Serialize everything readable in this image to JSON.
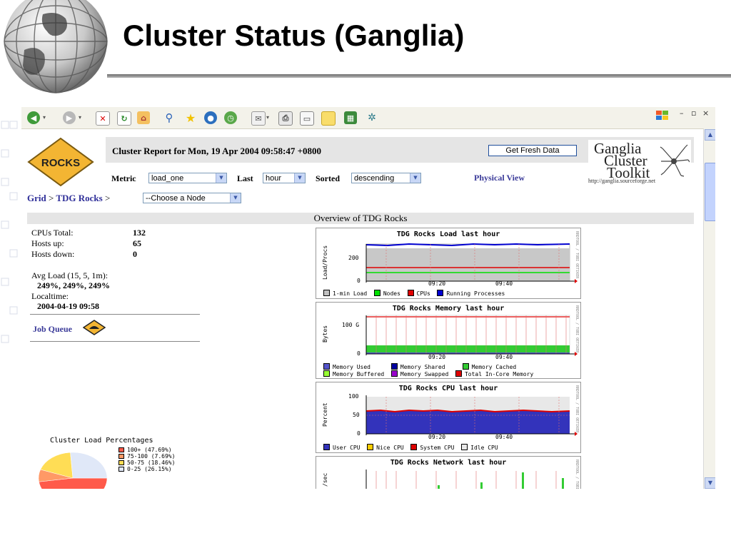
{
  "slide": {
    "title": "Cluster Status (Ganglia)"
  },
  "browser": {
    "toolbar_icons": [
      "back-icon",
      "forward-icon",
      "stop-icon",
      "refresh-icon",
      "home-icon",
      "search-icon",
      "favorites-star-icon",
      "media-icon",
      "history-icon",
      "mail-icon",
      "print-icon",
      "edit-icon",
      "folder-icon",
      "messenger-icon",
      "bluetooth-icon"
    ],
    "window_controls": {
      "minimize": "–",
      "restore": "▫",
      "close": "×"
    }
  },
  "header": {
    "logo_text": "ROCKS",
    "report_title": "Cluster Report for Mon, 19 Apr 2004 09:58:47 +0800",
    "fresh_button": "Get Fresh Data",
    "metric_label": "Metric",
    "metric_value": "load_one",
    "last_label": "Last",
    "last_value": "hour",
    "sorted_label": "Sorted",
    "sorted_value": "descending",
    "physical_view": "Physical View",
    "ganglia_logo": {
      "line1": "Ganglia",
      "line2": "Cluster",
      "line3": "Toolkit",
      "url": "http://ganglia.sourceforge.net"
    }
  },
  "breadcrumb": {
    "grid": "Grid",
    "sep1": ">",
    "cluster": "TDG Rocks",
    "sep2": ">",
    "node_select": "--Choose a Node"
  },
  "overview": {
    "title": "Overview of TDG Rocks",
    "cpus_total_label": "CPUs Total:",
    "cpus_total": "132",
    "hosts_up_label": "Hosts up:",
    "hosts_up": "65",
    "hosts_down_label": "Hosts down:",
    "hosts_down": "0",
    "avg_load_label": "Avg Load (15, 5, 1m):",
    "avg_load": "249%, 249%, 249%",
    "localtime_label": "Localtime:",
    "localtime": "2004-04-19 09:58",
    "job_queue": "Job Queue"
  },
  "graphs": {
    "load": {
      "title": "TDG Rocks Load last hour",
      "ylabel": "Load/Procs",
      "yticks": [
        "200",
        "0"
      ],
      "xticks": [
        "09:20",
        "09:40"
      ],
      "legend": [
        {
          "label": "1-min Load",
          "color": "#c0c0c0"
        },
        {
          "label": "Nodes",
          "color": "#00e000"
        },
        {
          "label": "CPUs",
          "color": "#e00000"
        },
        {
          "label": "Running Processes",
          "color": "#0000d0"
        }
      ]
    },
    "memory": {
      "title": "TDG Rocks Memory last hour",
      "ylabel": "Bytes",
      "yticks": [
        "100 G",
        "0"
      ],
      "xticks": [
        "09:20",
        "09:40"
      ],
      "legend": [
        {
          "label": "Memory Used",
          "color": "#5555cc"
        },
        {
          "label": "Memory Shared",
          "color": "#0000a0"
        },
        {
          "label": "Memory Cached",
          "color": "#33cc33"
        },
        {
          "label": "Memory Buffered",
          "color": "#99ff33"
        },
        {
          "label": "Memory Swapped",
          "color": "#9900cc"
        },
        {
          "label": "Total In-Core Memory",
          "color": "#e00000"
        }
      ]
    },
    "cpu": {
      "title": "TDG Rocks CPU last hour",
      "ylabel": "Percent",
      "yticks": [
        "100",
        "50",
        "0"
      ],
      "xticks": [
        "09:20",
        "09:40"
      ],
      "legend": [
        {
          "label": "User CPU",
          "color": "#3333bb"
        },
        {
          "label": "Nice CPU",
          "color": "#ffcc00"
        },
        {
          "label": "System CPU",
          "color": "#dd0000"
        },
        {
          "label": "Idle CPU",
          "color": "#e8e8e8"
        }
      ]
    },
    "network": {
      "title": "TDG Rocks Network last hour",
      "ylabel": "/sec"
    },
    "side_text": "RRDTOOL / TOBI OETIKER"
  },
  "chart_data": {
    "type": "pie",
    "title": "Cluster Load Percentages",
    "categories": [
      "100+",
      "75-100",
      "50-75",
      "0-25"
    ],
    "values": [
      47.69,
      7.69,
      18.46,
      26.15
    ],
    "legend_labels": [
      "100+ (47.69%)",
      "75-100 (7.69%)",
      "50-75 (18.46%)",
      "0-25 (26.15%)"
    ],
    "colors": [
      "#ff5a4a",
      "#ff9966",
      "#ffdd55",
      "#e0e8f8"
    ]
  }
}
